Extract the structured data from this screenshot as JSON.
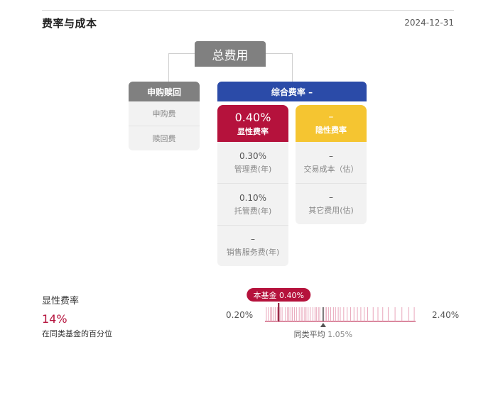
{
  "header": {
    "title": "费率与成本",
    "date": "2024-12-31"
  },
  "total": {
    "label": "总费用"
  },
  "purchase_redemption": {
    "title": "申购赎回",
    "items": [
      {
        "label": "申购费"
      },
      {
        "label": "赎回费"
      }
    ]
  },
  "composite": {
    "title": "综合费率 –",
    "explicit": {
      "value": "0.40%",
      "label": "显性费率",
      "items": [
        {
          "value": "0.30%",
          "label": "管理费(年)"
        },
        {
          "value": "0.10%",
          "label": "托管费(年)"
        },
        {
          "value": "–",
          "label": "销售服务费(年)"
        }
      ]
    },
    "hidden": {
      "value": "–",
      "label": "隐性费率",
      "items": [
        {
          "value": "–",
          "label": "交易成本（估）"
        },
        {
          "value": "–",
          "label": "其它费用(估)"
        }
      ]
    }
  },
  "percentile": {
    "title": "显性费率",
    "value": "14%",
    "caption": "在同类基金的百分位",
    "axis_min": "0.20%",
    "axis_max": "2.40%",
    "fund_label": "本基金 0.40%",
    "avg_label": "同类平均",
    "avg_value": "1.05%"
  },
  "colors": {
    "accent_red": "#b5123c",
    "composite_blue": "#2b4ba8",
    "hidden_yellow": "#f5c531",
    "header_gray": "#808080"
  },
  "chart_data": {
    "type": "strip",
    "title": "",
    "xlabel": "",
    "ylabel": "",
    "xlim": [
      0.2,
      2.4
    ],
    "fund_value": 0.4,
    "average_value": 1.05,
    "peer_values": [
      0.22,
      0.25,
      0.28,
      0.3,
      0.33,
      0.35,
      0.38,
      0.42,
      0.45,
      0.5,
      0.53,
      0.55,
      0.58,
      0.6,
      0.63,
      0.66,
      0.7,
      0.73,
      0.75,
      0.78,
      0.8,
      0.83,
      0.86,
      0.9,
      0.93,
      0.95,
      0.98,
      1.0,
      1.05,
      1.08,
      1.1,
      1.13,
      1.16,
      1.2,
      1.23,
      1.27,
      1.3,
      1.35,
      1.4,
      1.45,
      1.5,
      1.55,
      1.6,
      1.65,
      1.7,
      1.78,
      1.85,
      1.92,
      2.0,
      2.1,
      2.2,
      2.3,
      2.38
    ]
  }
}
